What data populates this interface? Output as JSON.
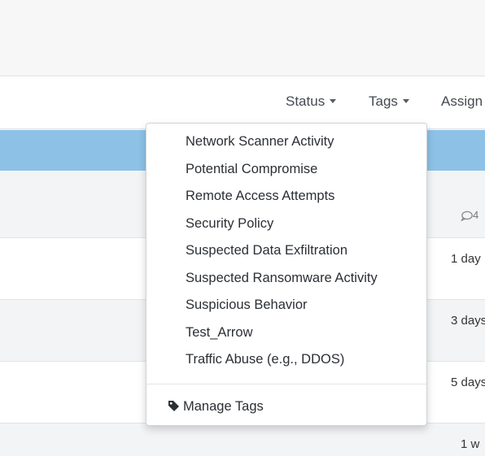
{
  "toolbar": {
    "status_label": "Status",
    "tags_label": "Tags",
    "assign_label": "Assign"
  },
  "rows": [
    {
      "meta": "4"
    },
    {
      "meta": "1 day"
    },
    {
      "meta": "3 days"
    },
    {
      "meta": "5 days"
    },
    {
      "meta": "1 w"
    }
  ],
  "tags_menu": {
    "items": [
      "Network Scanner Activity",
      "Potential Compromise",
      "Remote Access Attempts",
      "Security Policy",
      "Suspected Data Exfiltration",
      "Suspected Ransomware Activity",
      "Suspicious Behavior",
      "Test_Arrow",
      "Traffic Abuse (e.g., DDOS)"
    ],
    "manage_label": "Manage Tags",
    "manage_icon": "tag-icon"
  },
  "colors": {
    "header_blue": "#8dc2e6",
    "text": "#2b2f34"
  }
}
